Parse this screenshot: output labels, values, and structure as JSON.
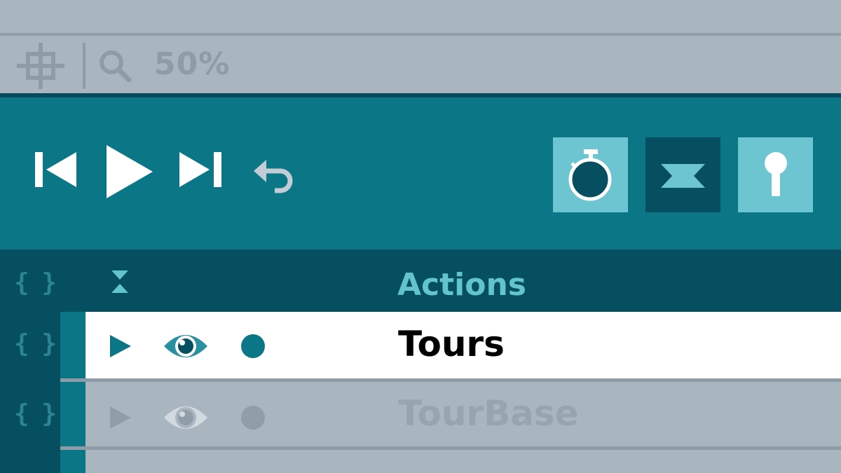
{
  "toolbar": {
    "zoom_level": "50%",
    "icons": [
      "crosshair-icon",
      "search-icon"
    ]
  },
  "player": {
    "controls": [
      "skip-back-icon",
      "play-icon",
      "skip-forward-icon",
      "undo-icon"
    ],
    "mode_buttons": [
      {
        "name": "stopwatch-icon",
        "active": false
      },
      {
        "name": "envelope-icon",
        "active": true
      },
      {
        "name": "keyhole-icon",
        "active": false
      }
    ]
  },
  "tree": {
    "header_label": "Actions",
    "rows": [
      {
        "label": "Tours",
        "selected": true
      },
      {
        "label": "TourBase",
        "selected": false
      }
    ],
    "brace_glyph": "{ }"
  },
  "colors": {
    "teal": "#0b7686",
    "dark_teal": "#054f60",
    "light_teal": "#63c3cf",
    "gray": "#a9b5bf"
  }
}
